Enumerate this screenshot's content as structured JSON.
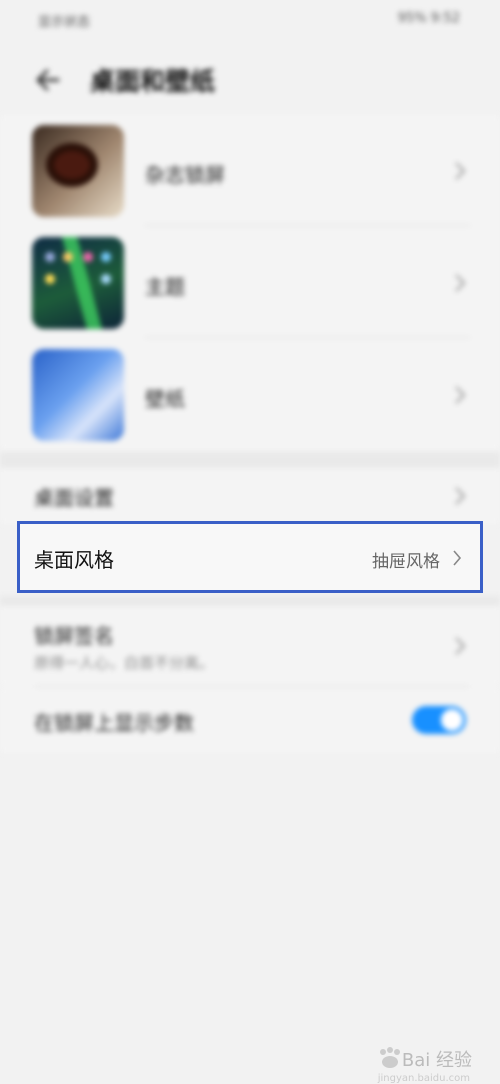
{
  "status_bar": {
    "left": "显示状态",
    "right": "95% 9:52"
  },
  "header": {
    "title": "桌面和壁纸"
  },
  "items": [
    {
      "label": "杂志锁屏"
    },
    {
      "label": "主题"
    },
    {
      "label": "壁纸"
    }
  ],
  "desktop_settings": {
    "label": "桌面设置"
  },
  "desktop_style": {
    "label": "桌面风格",
    "value": "抽屉风格"
  },
  "lock_signature": {
    "label": "锁屏签名",
    "sub": "原得一人心，白首不分离。"
  },
  "show_steps": {
    "label": "在锁屏上显示步数",
    "enabled": true
  },
  "watermark": {
    "brand": "Bai 经验",
    "url": "jingyan.baidu.com"
  }
}
